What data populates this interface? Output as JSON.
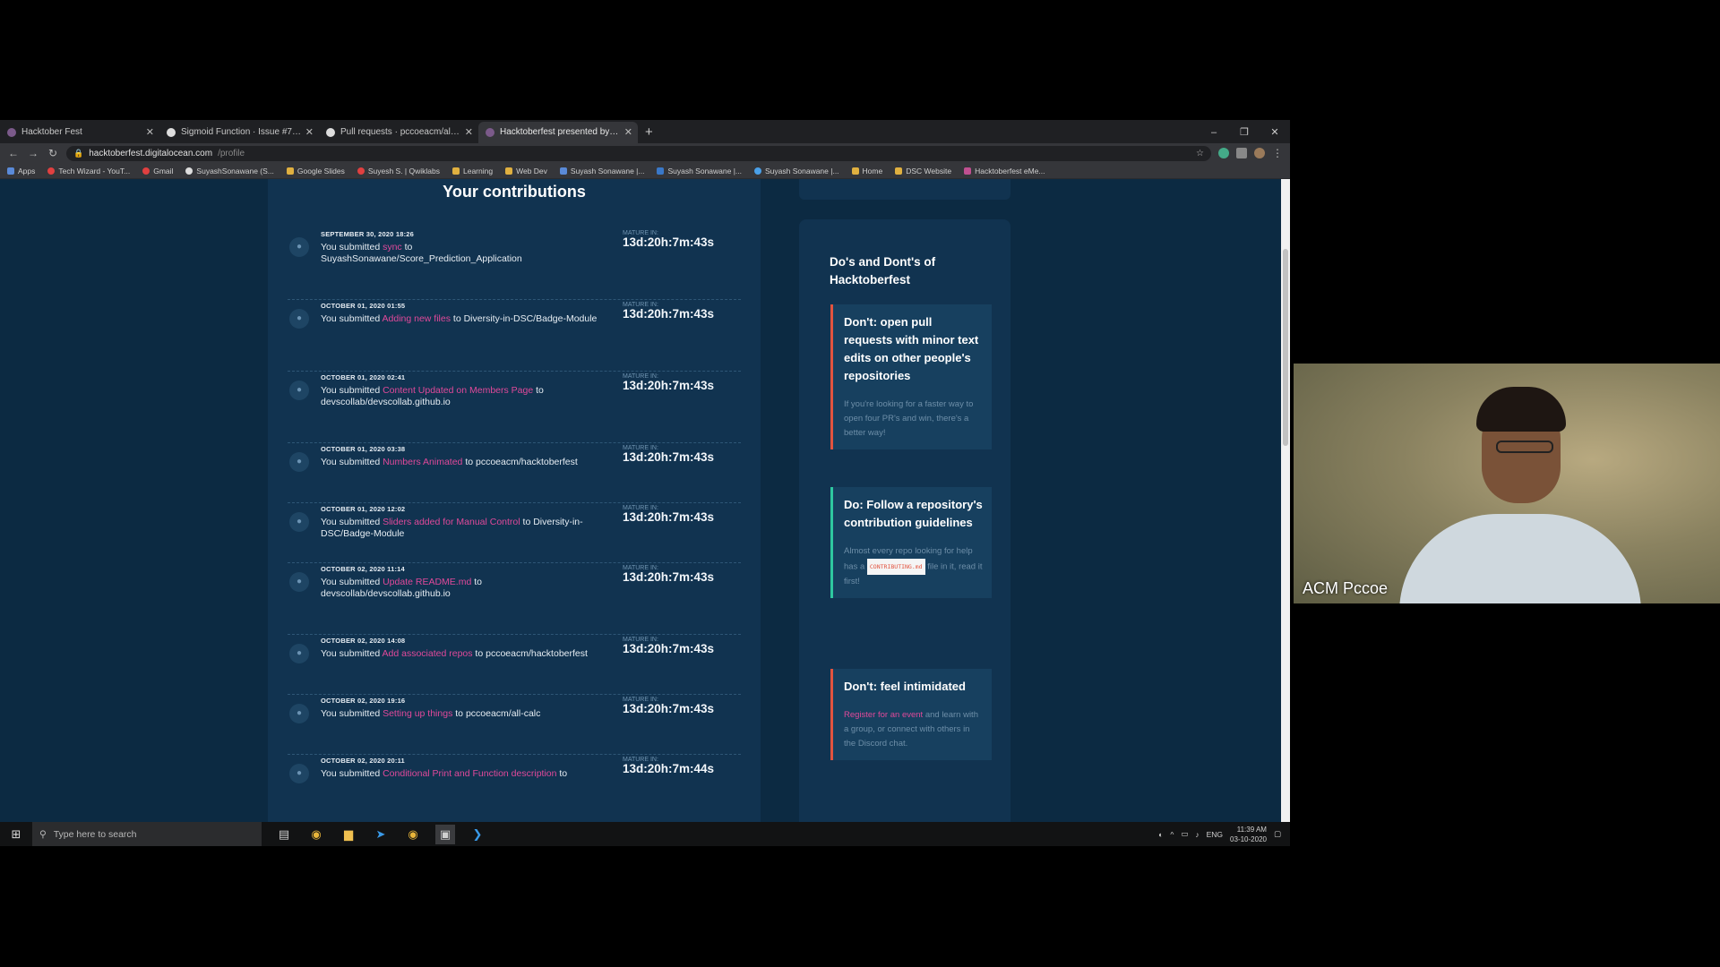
{
  "browser": {
    "tabs": [
      {
        "title": "Hacktober Fest"
      },
      {
        "title": "Sigmoid Function · Issue #7 · pc..."
      },
      {
        "title": "Pull requests · pccoeacm/all-calc"
      },
      {
        "title": "Hacktoberfest presented by Dig..."
      }
    ],
    "new_tab": "+",
    "url_host": "hacktoberfest.digitalocean.com",
    "url_path": "/profile",
    "bookmarks": [
      "Apps",
      "Tech Wizard - YouT...",
      "Gmail",
      "SuyashSonawane (S...",
      "Google Slides",
      "Suyesh S. | Qwiklabs",
      "Learning",
      "Web Dev",
      "Suyash Sonawane |...",
      "Suyash Sonawane |...",
      "Suyash Sonawane |...",
      "Home",
      "DSC Website",
      "Hacktoberfest eMe..."
    ]
  },
  "contributions": {
    "title": "Your contributions",
    "mature_label": "MATURE IN:",
    "submitted_prefix": "You submitted",
    "to_word": "to",
    "items": [
      {
        "date": "SEPTEMBER 30, 2020 18:26",
        "pr": "sync",
        "repo": "SuyashSonawane/Score_Prediction_Application",
        "mature": "13d:20h:7m:43s"
      },
      {
        "date": "OCTOBER 01, 2020 01:55",
        "pr": "Adding new files",
        "repo": "Diversity-in-DSC/Badge-Module",
        "mature": "13d:20h:7m:43s"
      },
      {
        "date": "OCTOBER 01, 2020 02:41",
        "pr": "Content Updated on Members Page",
        "repo": "devscollab/devscollab.github.io",
        "mature": "13d:20h:7m:43s"
      },
      {
        "date": "OCTOBER 01, 2020 03:38",
        "pr": "Numbers Animated",
        "repo": "pccoeacm/hacktoberfest",
        "mature": "13d:20h:7m:43s"
      },
      {
        "date": "OCTOBER 01, 2020 12:02",
        "pr": "Sliders added for Manual Control",
        "repo": "Diversity-in-DSC/Badge-Module",
        "mature": "13d:20h:7m:43s"
      },
      {
        "date": "OCTOBER 02, 2020 11:14",
        "pr": "Update README.md",
        "repo": "devscollab/devscollab.github.io",
        "mature": "13d:20h:7m:43s"
      },
      {
        "date": "OCTOBER 02, 2020 14:08",
        "pr": "Add associated repos",
        "repo": "pccoeacm/hacktoberfest",
        "mature": "13d:20h:7m:43s"
      },
      {
        "date": "OCTOBER 02, 2020 19:16",
        "pr": "Setting up things",
        "repo": "pccoeacm/all-calc",
        "mature": "13d:20h:7m:43s"
      },
      {
        "date": "OCTOBER 02, 2020 20:11",
        "pr": "Conditional Print and Function description",
        "repo": "",
        "mature": "13d:20h:7m:44s"
      }
    ]
  },
  "tips": {
    "title": "Do's and Dont's of Hacktoberfest",
    "cards": [
      {
        "heading": "Don't: open pull requests with minor text edits on other people's repositories",
        "body": "If you're looking for a faster way to open four PR's and win, there's a better way!"
      },
      {
        "heading": "Do: Follow a repository's contribution guidelines",
        "body_pre": "Almost every repo looking for help has a",
        "badge": "CONTRIBUTING.md",
        "body_post": "file in it, read it first!"
      },
      {
        "heading": "Don't: feel intimidated",
        "link": "Register for an event",
        "body": "and learn with a group, or connect with others in the Discord chat."
      }
    ]
  },
  "taskbar": {
    "search_placeholder": "Type here to search",
    "language": "ENG",
    "time": "11:39 AM",
    "date": "03-10-2020"
  },
  "webcam": {
    "participant_name": "ACM Pccoe"
  },
  "colors": {
    "page_bg": "#0c2a42",
    "panel_bg": "#113350",
    "link": "#e0499a",
    "dont_accent": "#e2533f",
    "do_accent": "#2ec8a0"
  }
}
